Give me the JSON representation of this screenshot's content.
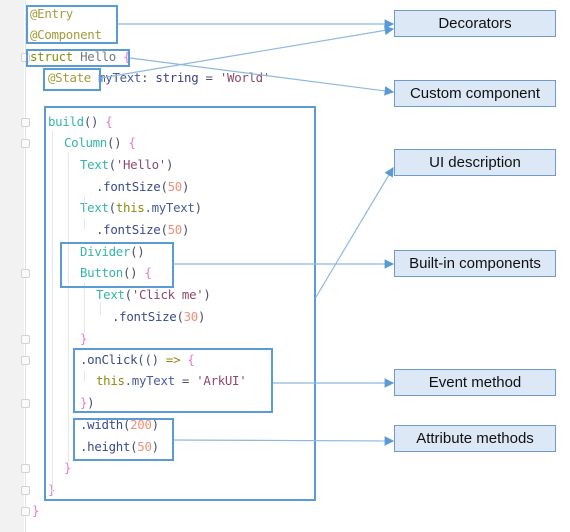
{
  "colors": {
    "decorator": "#a59a3a",
    "keyword": "#8a8a10",
    "ident": "#707a80",
    "var": "#4a5a9a",
    "type": "#3a3f8a",
    "string": "#8b4a6a",
    "component": "#35b5a8",
    "method": "#3a4a8a",
    "number": "#f08f78",
    "brace": "#e27ad0",
    "punct": "#4a5070",
    "this": "#8a8a10",
    "highlight": "#5b9bd5",
    "label_bg": "#dce8f5"
  },
  "code_lines": [
    [
      {
        "t": "@Entry",
        "c": "decorator"
      }
    ],
    [
      {
        "t": "@Component",
        "c": "decorator"
      }
    ],
    [
      {
        "t": "struct",
        "c": "keyword"
      },
      {
        "t": " Hello ",
        "c": "ident"
      },
      {
        "t": "{",
        "c": "brace"
      }
    ],
    [
      {
        "t": "@State",
        "c": "decorator"
      },
      {
        "t": " myText",
        "c": "var"
      },
      {
        "t": ": ",
        "c": "punct"
      },
      {
        "t": "string",
        "c": "type"
      },
      {
        "t": " = ",
        "c": "punct"
      },
      {
        "t": "'World'",
        "c": "string"
      }
    ],
    [],
    [
      {
        "t": "build",
        "c": "component"
      },
      {
        "t": "() ",
        "c": "punct"
      },
      {
        "t": "{",
        "c": "brace"
      }
    ],
    [
      {
        "t": "Column",
        "c": "component"
      },
      {
        "t": "() ",
        "c": "punct"
      },
      {
        "t": "{",
        "c": "brace"
      }
    ],
    [
      {
        "t": "Text",
        "c": "component"
      },
      {
        "t": "(",
        "c": "punct"
      },
      {
        "t": "'Hello'",
        "c": "string"
      },
      {
        "t": ")",
        "c": "punct"
      }
    ],
    [
      {
        "t": ".fontSize",
        "c": "method"
      },
      {
        "t": "(",
        "c": "punct"
      },
      {
        "t": "50",
        "c": "number"
      },
      {
        "t": ")",
        "c": "punct"
      }
    ],
    [
      {
        "t": "Text",
        "c": "component"
      },
      {
        "t": "(",
        "c": "punct"
      },
      {
        "t": "this",
        "c": "this"
      },
      {
        "t": ".myText",
        "c": "var"
      },
      {
        "t": ")",
        "c": "punct"
      }
    ],
    [
      {
        "t": ".fontSize",
        "c": "method"
      },
      {
        "t": "(",
        "c": "punct"
      },
      {
        "t": "50",
        "c": "number"
      },
      {
        "t": ")",
        "c": "punct"
      }
    ],
    [
      {
        "t": "Divider",
        "c": "component"
      },
      {
        "t": "()",
        "c": "punct"
      }
    ],
    [
      {
        "t": "Button",
        "c": "component"
      },
      {
        "t": "() ",
        "c": "punct"
      },
      {
        "t": "{",
        "c": "brace"
      }
    ],
    [
      {
        "t": "Text",
        "c": "component"
      },
      {
        "t": "(",
        "c": "punct"
      },
      {
        "t": "'Click me'",
        "c": "string"
      },
      {
        "t": ")",
        "c": "punct"
      }
    ],
    [
      {
        "t": ".fontSize",
        "c": "method"
      },
      {
        "t": "(",
        "c": "punct"
      },
      {
        "t": "30",
        "c": "number"
      },
      {
        "t": ")",
        "c": "punct"
      }
    ],
    [
      {
        "t": "}",
        "c": "brace"
      }
    ],
    [
      {
        "t": ".onClick",
        "c": "method"
      },
      {
        "t": "(() ",
        "c": "punct"
      },
      {
        "t": "=>",
        "c": "keyword"
      },
      {
        "t": " ",
        "c": "punct"
      },
      {
        "t": "{",
        "c": "brace"
      }
    ],
    [
      {
        "t": "this",
        "c": "this"
      },
      {
        "t": ".myText",
        "c": "var"
      },
      {
        "t": " = ",
        "c": "punct"
      },
      {
        "t": "'ArkUI'",
        "c": "string"
      }
    ],
    [
      {
        "t": "}",
        "c": "brace"
      },
      {
        "t": ")",
        "c": "punct"
      }
    ],
    [
      {
        "t": ".width",
        "c": "method"
      },
      {
        "t": "(",
        "c": "punct"
      },
      {
        "t": "200",
        "c": "number"
      },
      {
        "t": ")",
        "c": "punct"
      }
    ],
    [
      {
        "t": ".height",
        "c": "method"
      },
      {
        "t": "(",
        "c": "punct"
      },
      {
        "t": "50",
        "c": "number"
      },
      {
        "t": ")",
        "c": "punct"
      }
    ],
    [
      {
        "t": "}",
        "c": "brace"
      }
    ],
    [
      {
        "t": "}",
        "c": "brace"
      }
    ],
    [
      {
        "t": "}",
        "c": "brace"
      }
    ]
  ],
  "labels": {
    "decorators": "Decorators",
    "custom_component": "Custom component",
    "ui_description": "UI description",
    "built_in_components": "Built-in components",
    "event_method": "Event method",
    "attribute_methods": "Attribute methods"
  }
}
